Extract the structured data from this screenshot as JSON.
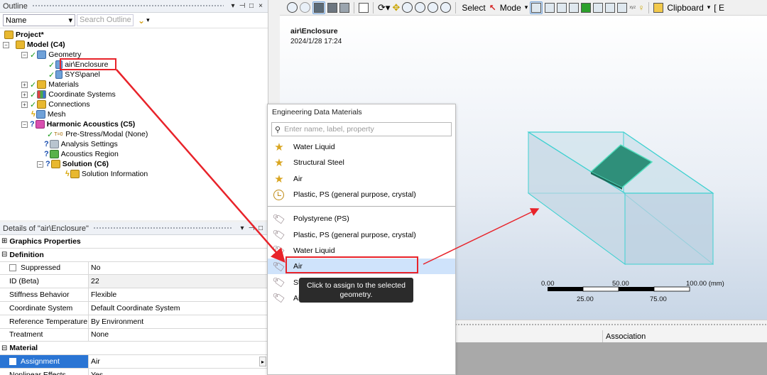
{
  "outline": {
    "title": "Outline",
    "controls": [
      "▾",
      "⊣",
      "□",
      "×"
    ],
    "name_select": "Name",
    "search_placeholder": "Search Outline",
    "tree": {
      "project": "Project*",
      "model": "Model (C4)",
      "geometry": "Geometry",
      "air_enclosure": "air\\Enclosure",
      "sys_panel": "SYS\\panel",
      "materials": "Materials",
      "coordinate_systems": "Coordinate Systems",
      "connections": "Connections",
      "mesh": "Mesh",
      "harmonic": "Harmonic Acoustics (C5)",
      "prestress": "Pre-Stress/Modal (None)",
      "analysis_settings": "Analysis Settings",
      "acoustics_region": "Acoustics Region",
      "solution": "Solution (C6)",
      "solution_info": "Solution Information"
    }
  },
  "details": {
    "title": "Details of \"air\\Enclosure\"",
    "controls": [
      "▾",
      "⊣",
      "□"
    ],
    "rows": {
      "graphics_properties": "Graphics Properties",
      "definition": "Definition",
      "suppressed_k": "Suppressed",
      "suppressed_v": "No",
      "id_k": "ID (Beta)",
      "id_v": "22",
      "stiffness_k": "Stiffness Behavior",
      "stiffness_v": "Flexible",
      "coord_k": "Coordinate System",
      "coord_v": "Default Coordinate System",
      "reftemp_k": "Reference Temperature",
      "reftemp_v": "By Environment",
      "treatment_k": "Treatment",
      "treatment_v": "None",
      "material": "Material",
      "assignment_k": "Assignment",
      "assignment_v": "Air",
      "nonlinear_k": "Nonlinear Effects",
      "nonlinear_v": "Yes"
    }
  },
  "toolbar": {
    "select": "Select",
    "mode": "Mode",
    "clipboard": "Clipboard",
    "trailing": "[ E"
  },
  "viewport": {
    "title": "air\\Enclosure",
    "date": "2024/1/28 17:24",
    "scale": {
      "l0": "0.00",
      "l50": "50.00",
      "l100": "100.00 (mm)",
      "l25": "25.00",
      "l75": "75.00"
    }
  },
  "association_header": "Association",
  "engineering_data": {
    "title": "Engineering Data Materials",
    "search_placeholder": "Enter name, label, property",
    "favorites": [
      "Water Liquid",
      "Structural Steel",
      "Air"
    ],
    "recent": [
      "Plastic, PS (general purpose, crystal)"
    ],
    "library": [
      "Polystyrene (PS)",
      "Plastic, PS (general purpose, crystal)",
      "Water Liquid",
      "Air",
      "St",
      "Ai"
    ],
    "tooltip": "Click to assign to the selected geometry."
  },
  "colors": {
    "highlight_red": "#e8232a",
    "selection_blue": "#2a75d4",
    "enclosure_edge": "#3fd1d1",
    "panel_fill": "#2f8f7a"
  }
}
